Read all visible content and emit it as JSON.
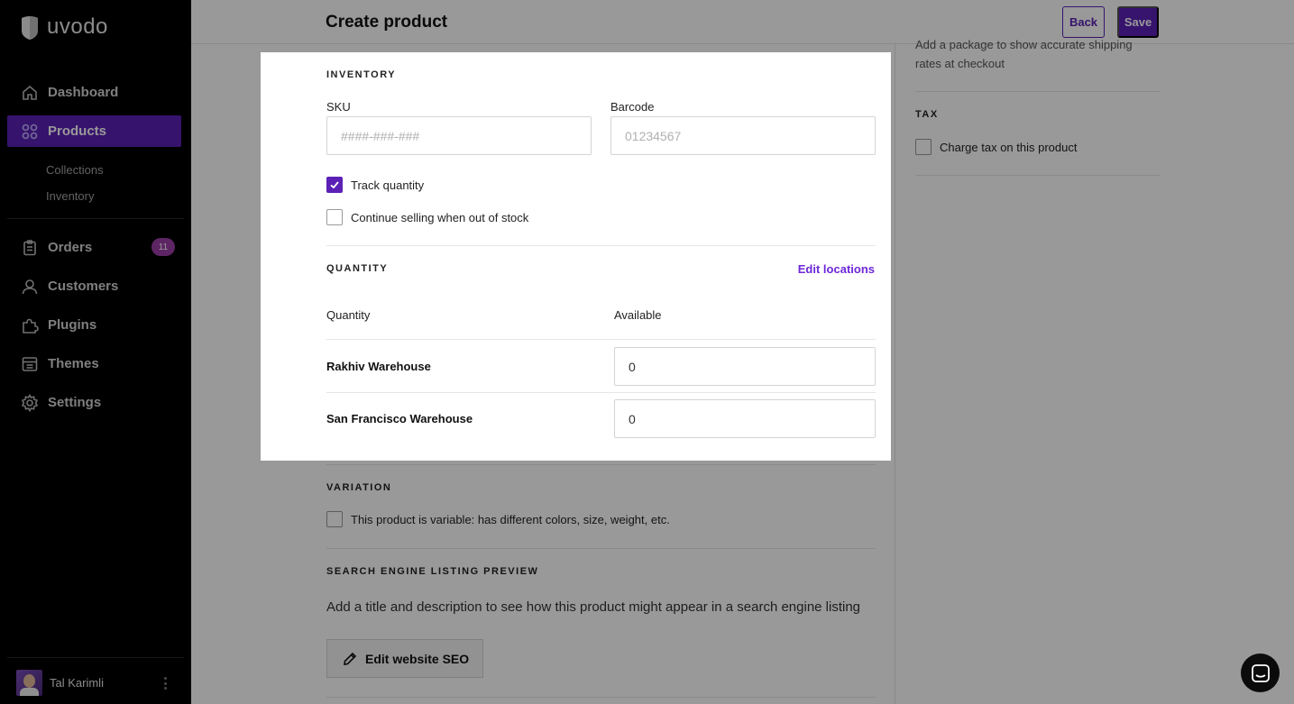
{
  "app": {
    "brand": "uvodo"
  },
  "sidebar": {
    "items": [
      {
        "label": "Dashboard",
        "icon": "home-icon"
      },
      {
        "label": "Products",
        "icon": "grid-icon",
        "active": true
      },
      {
        "label": "Orders",
        "icon": "clipboard-icon",
        "badge": "11"
      },
      {
        "label": "Customers",
        "icon": "user-icon"
      },
      {
        "label": "Plugins",
        "icon": "puzzle-icon"
      },
      {
        "label": "Themes",
        "icon": "layout-icon"
      },
      {
        "label": "Settings",
        "icon": "gear-icon"
      }
    ],
    "subitems": [
      {
        "label": "Collections"
      },
      {
        "label": "Inventory"
      }
    ],
    "user": {
      "name": "Tal Karimli"
    }
  },
  "header": {
    "title": "Create product",
    "back_label": "Back",
    "save_label": "Save"
  },
  "main": {
    "variation": {
      "title": "VARIATION",
      "checkbox_label": "This product is variable: has different colors, size, weight, etc."
    },
    "seo": {
      "title": "SEARCH ENGINE LISTING PREVIEW",
      "description": "Add a title and description to see how this product might appear in a search engine listing",
      "button_label": "Edit website SEO"
    }
  },
  "right": {
    "shipping_desc": "Add a package to show accurate shipping rates at checkout",
    "tax": {
      "title": "TAX",
      "checkbox_label": "Charge tax on this product"
    }
  },
  "modal": {
    "inventory": {
      "title": "INVENTORY",
      "sku": {
        "label": "SKU",
        "placeholder": "####-###-###"
      },
      "barcode": {
        "label": "Barcode",
        "placeholder": "01234567"
      },
      "track_quantity": {
        "label": "Track quantity",
        "checked": true
      },
      "continue_selling": {
        "label": "Continue selling when out of stock",
        "checked": false
      }
    },
    "quantity": {
      "title": "QUANTITY",
      "edit_locations_label": "Edit locations",
      "col_quantity": "Quantity",
      "col_available": "Available",
      "rows": [
        {
          "name": "Rakhiv Warehouse",
          "available": "0"
        },
        {
          "name": "San Francisco Warehouse",
          "available": "0"
        }
      ]
    }
  },
  "colors": {
    "accent": "#5b21b6",
    "sidebar_bg": "#000000",
    "badge": "#9d3ea8",
    "link": "#6d28d9"
  }
}
